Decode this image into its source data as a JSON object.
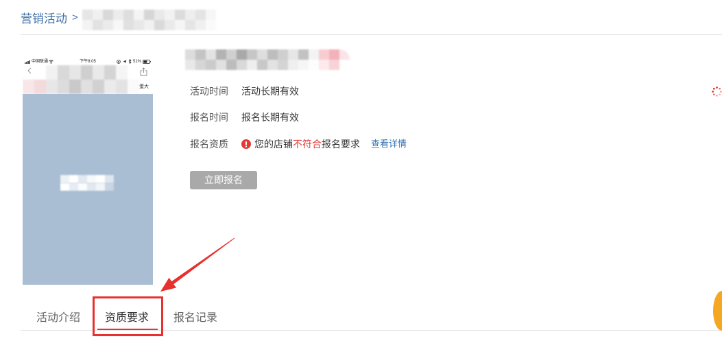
{
  "breadcrumb": {
    "root": "营销活动",
    "separator": ">"
  },
  "phone_preview": {
    "status_bar": {
      "carrier": "中国联通",
      "time": "下午8:05",
      "battery": "51%",
      "icons": [
        "signal-icon",
        "wifi-icon",
        "lock-rotation-icon",
        "location-arrow-icon",
        "bluetooth-icon",
        "battery-icon"
      ]
    },
    "nav_icons": [
      "back-icon",
      "share-icon"
    ],
    "shop_label": "蛋大"
  },
  "activity": {
    "info_rows": [
      {
        "label": "活动时间",
        "value": "活动长期有效"
      },
      {
        "label": "报名时间",
        "value": "报名长期有效"
      }
    ],
    "qualification": {
      "label": "报名资质",
      "icon": "alert-circle-icon",
      "text_before": "您的店铺",
      "status": "不符合",
      "text_after": "报名要求",
      "detail_link": "查看详情"
    },
    "signup_button": "立即报名",
    "signup_enabled": false
  },
  "tabs": {
    "items": [
      {
        "label": "活动介绍",
        "active": false
      },
      {
        "label": "资质要求",
        "active": true
      },
      {
        "label": "报名记录",
        "active": false
      }
    ]
  },
  "edge_widgets": [
    "loading-spinner-icon",
    "floating-help-button"
  ],
  "colors": {
    "breadcrumb_link": "#3c6ea6",
    "detail_link": "#2e6fb2",
    "warning": "#e33b3b",
    "signup_button_disabled": "#a9a9a9",
    "phone_banner": "#a9bdd3",
    "annotation": "#e8302c",
    "tab_active_underline": "#e8302c",
    "floating_button": "#f5a623"
  }
}
